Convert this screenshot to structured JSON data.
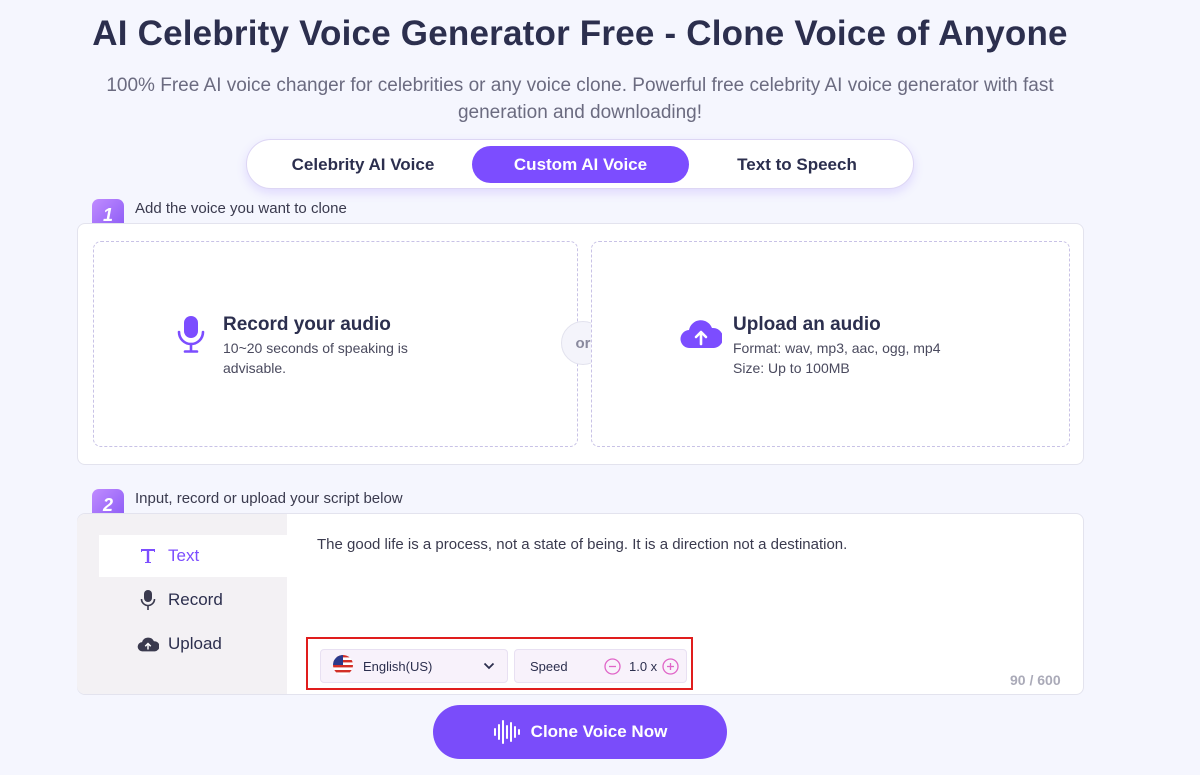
{
  "header": {
    "title": "AI Celebrity Voice Generator Free - Clone Voice of Anyone",
    "subtitle": "100% Free AI voice changer for celebrities or any voice clone. Powerful free celebrity AI voice generator with fast generation and downloading!"
  },
  "tabs": [
    {
      "label": "Celebrity AI Voice",
      "active": false
    },
    {
      "label": "Custom AI Voice",
      "active": true
    },
    {
      "label": "Text to Speech",
      "active": false
    }
  ],
  "step1": {
    "number": "1",
    "label": "Add the voice you want to clone",
    "record": {
      "title": "Record your audio",
      "desc": "10~20 seconds of speaking is advisable.",
      "icon": "microphone-icon"
    },
    "separator": "or",
    "upload": {
      "title": "Upload an audio",
      "desc_format": "Format: wav, mp3, aac, ogg, mp4",
      "desc_size": "Size: Up to 100MB",
      "icon": "cloud-upload-icon"
    }
  },
  "step2": {
    "number": "2",
    "label": "Input, record or upload your script below",
    "modes": [
      {
        "label": "Text",
        "icon": "text-icon",
        "active": true
      },
      {
        "label": "Record",
        "icon": "microphone-icon",
        "active": false
      },
      {
        "label": "Upload",
        "icon": "cloud-upload-icon",
        "active": false
      }
    ],
    "script_text": "The good life is a process, not a state of being. It is a direction not a destination.",
    "language": "English(US)",
    "speed_label": "Speed",
    "speed_value": "1.0 x",
    "char_count": "90 / 600"
  },
  "action": {
    "label": "Clone Voice Now"
  },
  "colors": {
    "accent": "#7c4dff",
    "highlight_box": "#e01d1d",
    "background": "#f5f6fe"
  }
}
